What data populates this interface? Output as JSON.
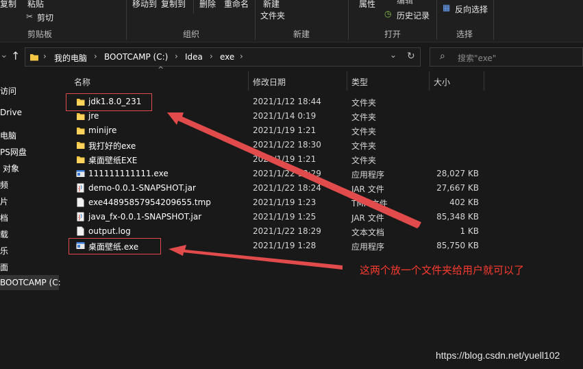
{
  "ribbon": {
    "copy_label": "复制",
    "paste_label": "粘贴",
    "cut_label": "剪切",
    "move_to_label": "移动到",
    "copy_to_label": "复制到",
    "delete_label": "删除",
    "rename_label": "重命名",
    "new_label": "新建",
    "new_folder_label": "文件夹",
    "properties_label": "属性",
    "edit_label": "编辑",
    "history_label": "历史记录",
    "invert_select_label": "反向选择",
    "groups": {
      "clipboard": "剪贴板",
      "organize": "组织",
      "new": "新建",
      "open": "打开",
      "select": "选择"
    }
  },
  "address": {
    "crumbs": [
      "我的电脑",
      "BOOTCAMP (C:)",
      "Idea",
      "exe"
    ],
    "search_placeholder": "搜索\"exe\""
  },
  "sidebar": {
    "items": [
      "访问",
      "Drive",
      "电脑",
      "PS网盘",
      "对象",
      "频",
      "片",
      "档",
      "载",
      "乐",
      "面",
      "BOOTCAMP (C:)"
    ]
  },
  "columns": {
    "name": "名称",
    "date": "修改日期",
    "type": "类型",
    "size": "大小"
  },
  "files": [
    {
      "name": "jdk1.8.0_231",
      "date": "2021/1/12 18:44",
      "type": "文件夹",
      "size": "",
      "icon": "folder-icon"
    },
    {
      "name": "jre",
      "date": "2021/1/14 0:19",
      "type": "文件夹",
      "size": "",
      "icon": "folder-icon"
    },
    {
      "name": "minijre",
      "date": "2021/1/19 1:21",
      "type": "文件夹",
      "size": "",
      "icon": "folder-icon"
    },
    {
      "name": "我打好的exe",
      "date": "2021/1/22 18:30",
      "type": "文件夹",
      "size": "",
      "icon": "folder-icon"
    },
    {
      "name": "桌面壁纸EXE",
      "date": "2021/1/19 1:21",
      "type": "文件夹",
      "size": "",
      "icon": "folder-icon"
    },
    {
      "name": "111111111111.exe",
      "date": "2021/1/22 18:29",
      "type": "应用程序",
      "size": "28,027 KB",
      "icon": "exe-icon"
    },
    {
      "name": "demo-0.0.1-SNAPSHOT.jar",
      "date": "2021/1/22 18:24",
      "type": "JAR 文件",
      "size": "27,667 KB",
      "icon": "jar-icon"
    },
    {
      "name": "exe44895857954209655.tmp",
      "date": "2021/1/19 1:23",
      "type": "TMP 文件",
      "size": "402 KB",
      "icon": "file-icon"
    },
    {
      "name": "java_fx-0.0.1-SNAPSHOT.jar",
      "date": "2021/1/19 1:25",
      "type": "JAR 文件",
      "size": "85,348 KB",
      "icon": "jar-icon"
    },
    {
      "name": "output.log",
      "date": "2021/1/22 18:29",
      "type": "文本文档",
      "size": "1 KB",
      "icon": "file-icon"
    },
    {
      "name": "桌面壁纸.exe",
      "date": "2021/1/19 1:28",
      "type": "应用程序",
      "size": "85,750 KB",
      "icon": "exe-icon"
    }
  ],
  "annotation": {
    "note": "这两个放一个文件夹给用户就可以了",
    "color": "#ff3b30"
  },
  "watermark": "https://blog.csdn.net/yuell102",
  "colors": {
    "background": "#191919",
    "folder": "#f4c542",
    "accent_red": "#e24b4b"
  }
}
